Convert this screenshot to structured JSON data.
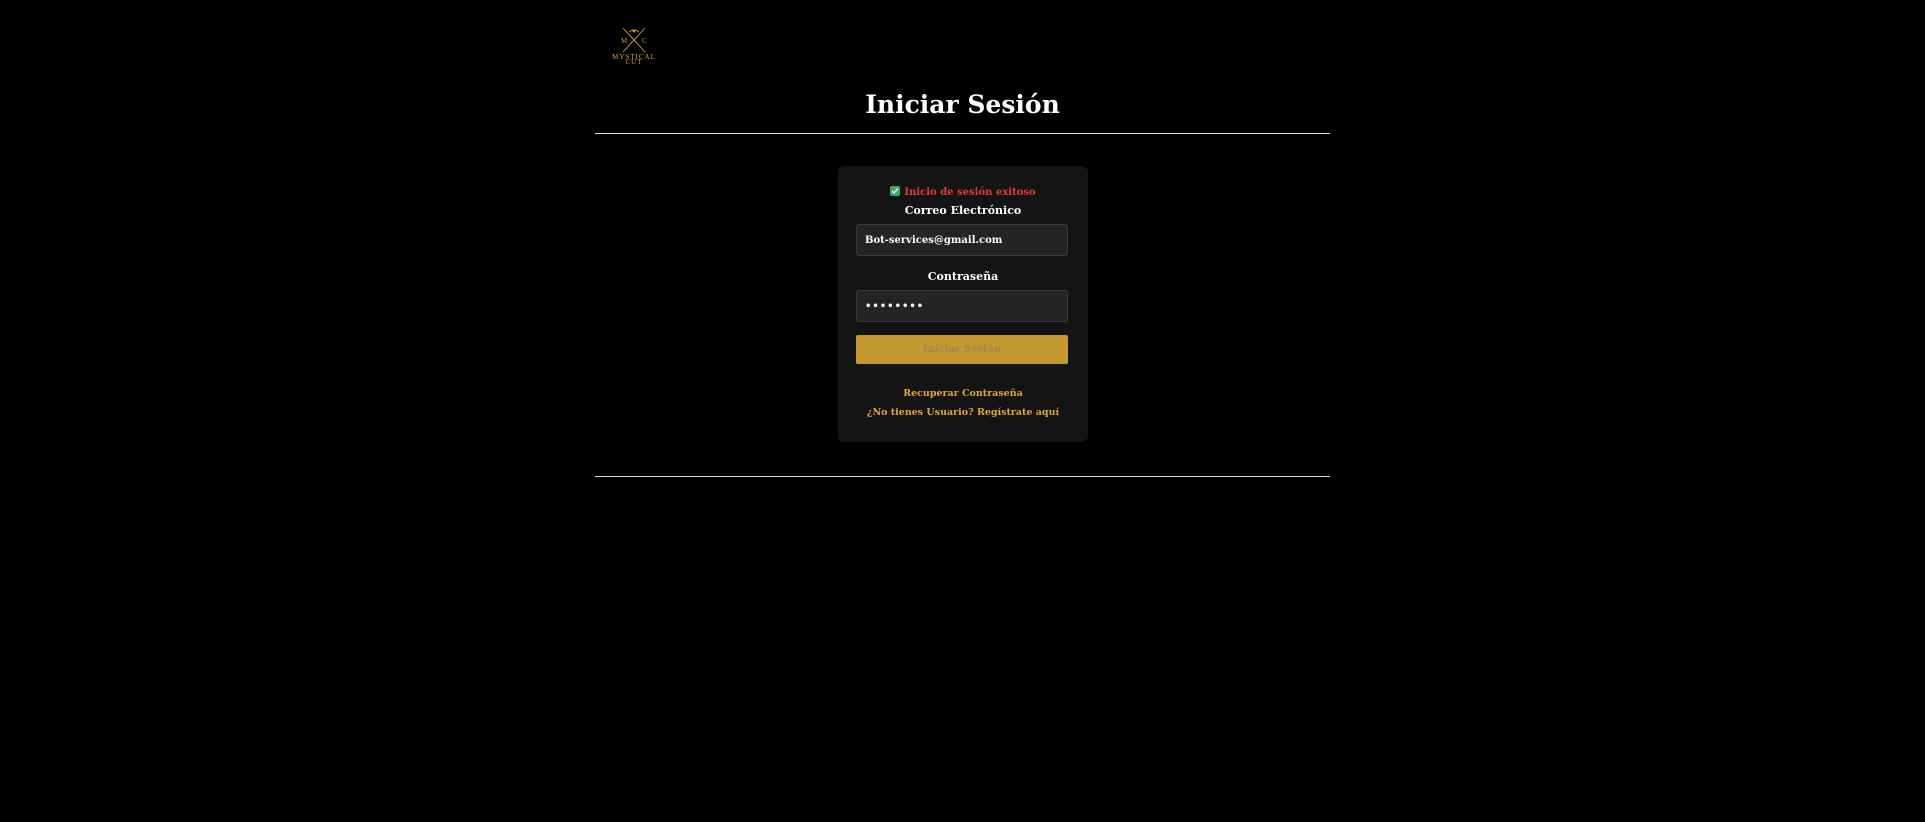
{
  "logo": {
    "brand_line1": "MYSTICAL",
    "brand_line2": "CUT",
    "initials_left": "M",
    "initials_right": "C",
    "color": "#c9a23a"
  },
  "page_title": "Iniciar Sesión",
  "alert": {
    "text": "Inicio de sesión exitoso",
    "icon": "check-box-icon",
    "color": "#e23b3b",
    "icon_color": "#35a86a"
  },
  "form": {
    "email_label": "Correo Electrónico",
    "email_value": "Bot-services@gmail.com",
    "password_label": "Contraseña",
    "password_value": "••••••••",
    "submit_label": "Iniciar Sesión"
  },
  "links": {
    "recover": "Recuperar Contraseña",
    "register": "¿No tienes Usuario? Regístrate aquí"
  },
  "colors": {
    "background": "#000000",
    "card": "#141414",
    "accent": "#c49a30",
    "link": "#e0a930"
  }
}
